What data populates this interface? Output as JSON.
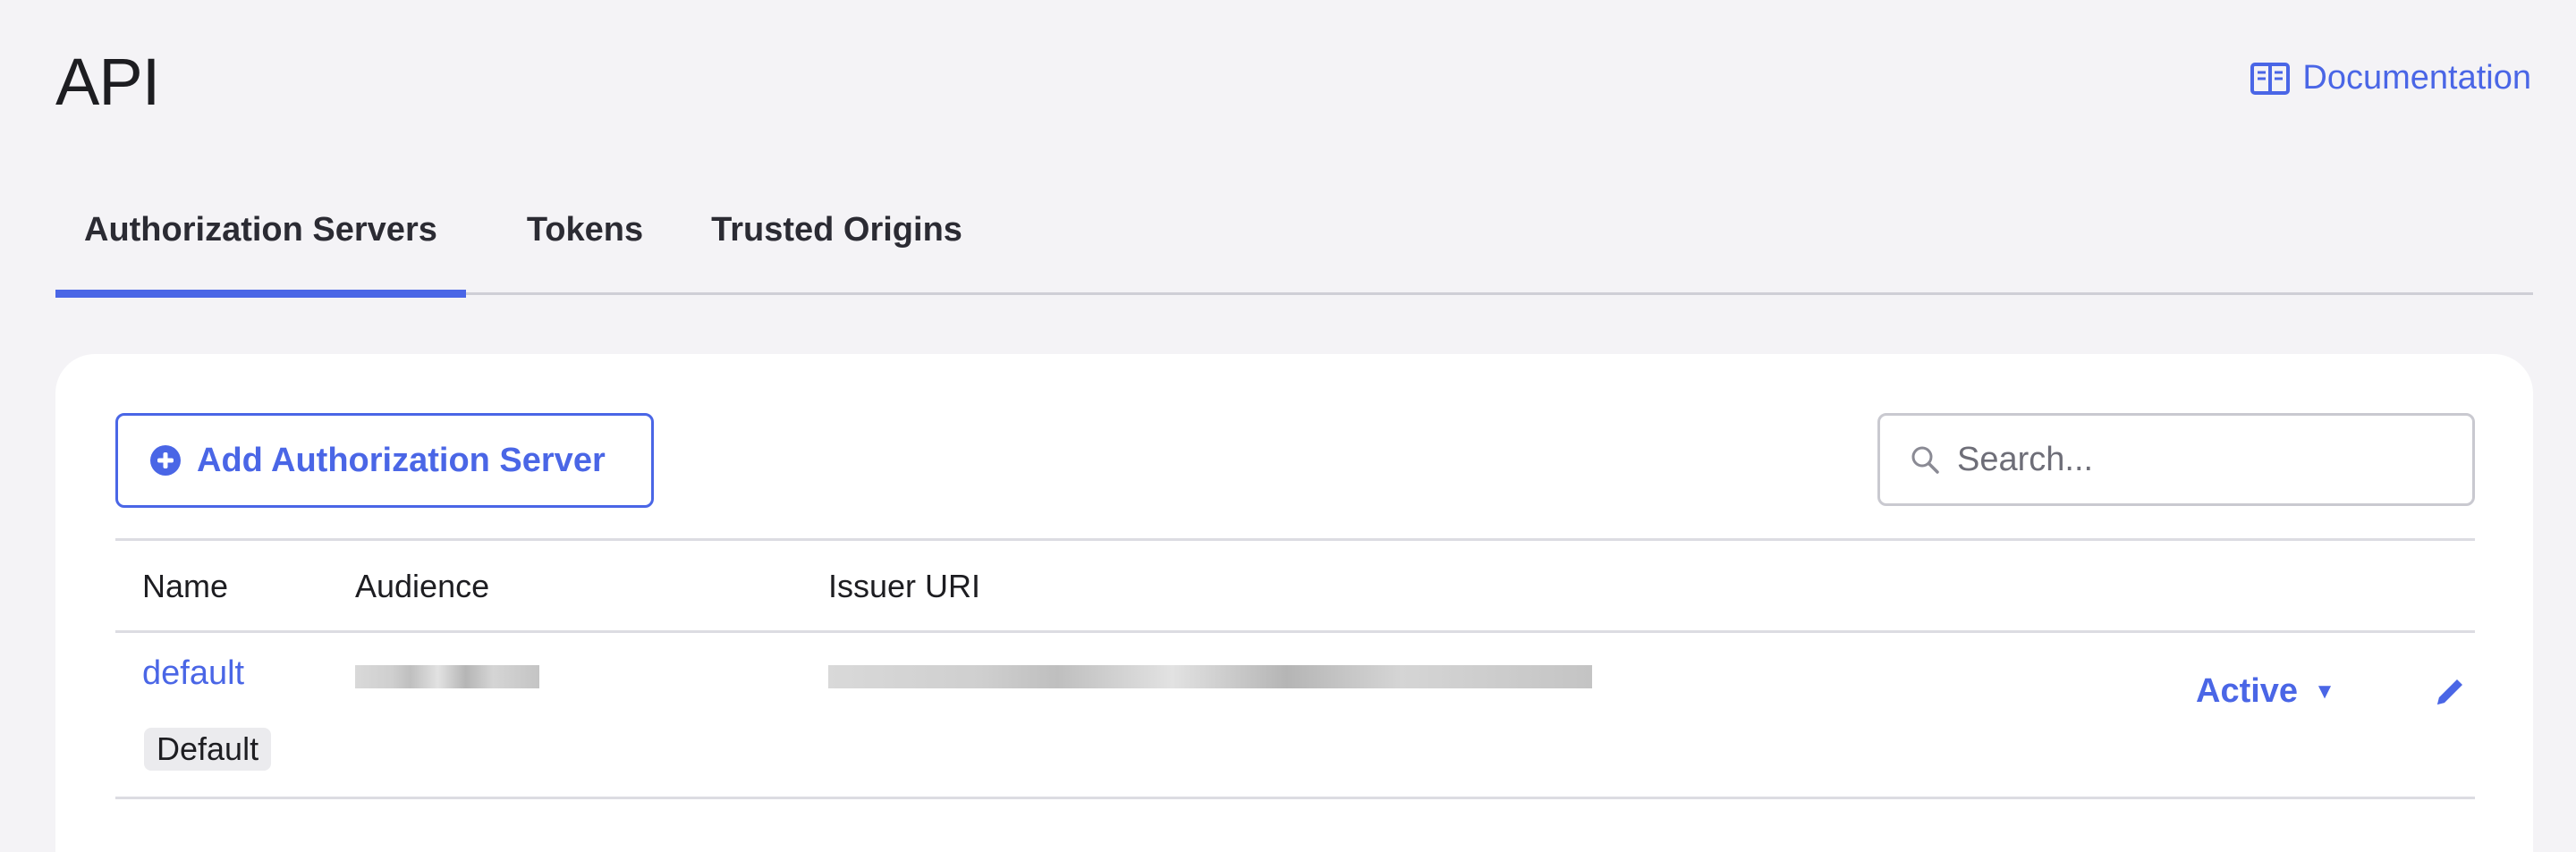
{
  "page": {
    "title": "API",
    "documentation_label": "Documentation"
  },
  "tabs": [
    {
      "label": "Authorization Servers",
      "active": true
    },
    {
      "label": "Tokens",
      "active": false
    },
    {
      "label": "Trusted Origins",
      "active": false
    }
  ],
  "toolbar": {
    "add_button_label": "Add Authorization Server",
    "search_placeholder": "Search..."
  },
  "table": {
    "headers": [
      "Name",
      "Audience",
      "Issuer URI"
    ],
    "rows": [
      {
        "name": "default",
        "badge": "Default",
        "status": "Active"
      }
    ]
  },
  "icons": {
    "documentation": "book-icon",
    "add": "plus-circle-icon",
    "search": "search-icon",
    "status_dropdown": "caret-down-icon",
    "edit": "pencil-icon"
  },
  "colors": {
    "accent": "#4a66e6",
    "background": "#f4f3f6"
  }
}
